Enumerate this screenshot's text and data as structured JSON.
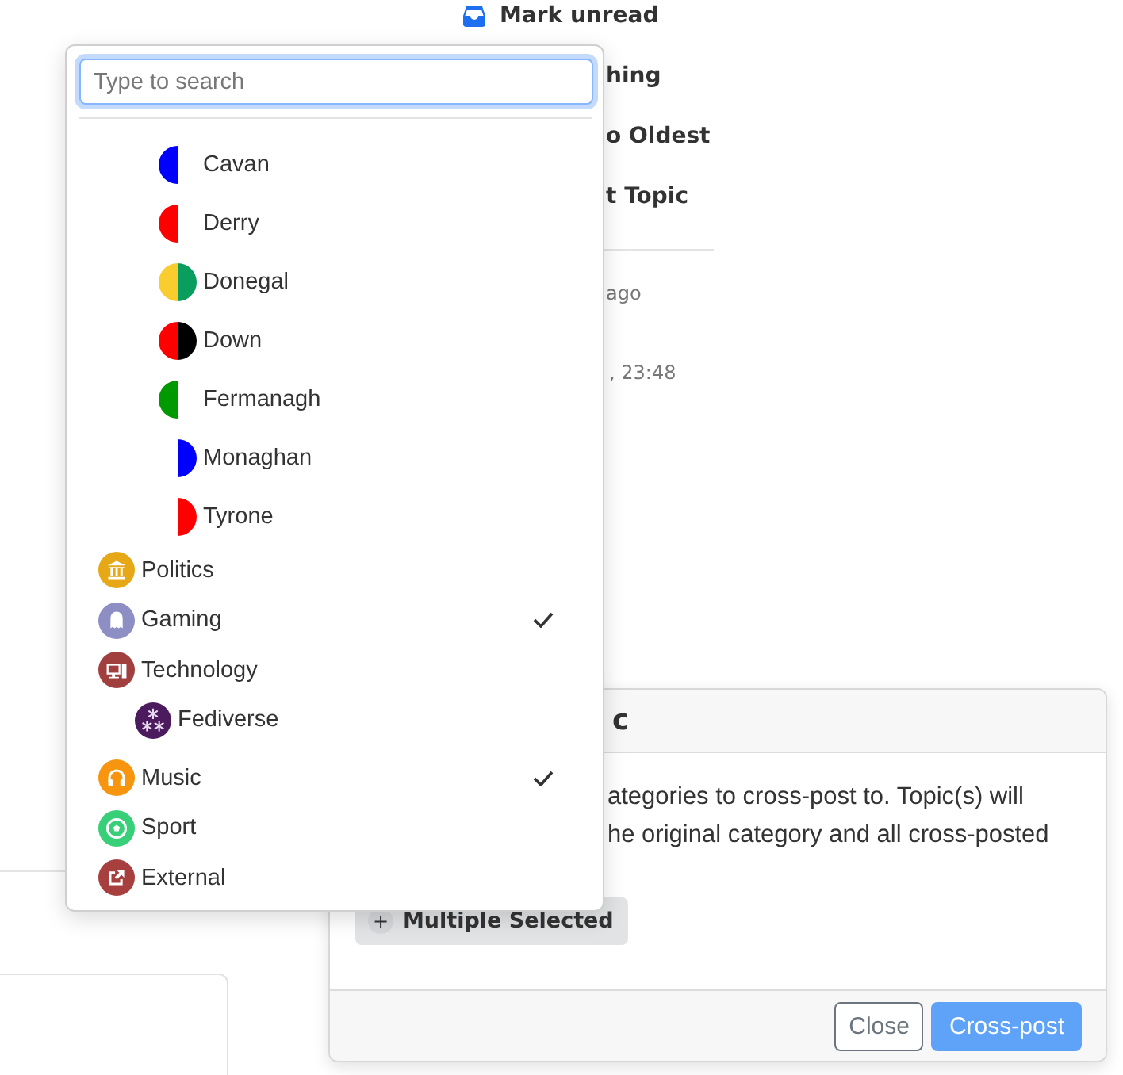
{
  "menu": [
    {
      "label": "Mark unread",
      "kind": "icon"
    },
    {
      "label": "hing",
      "kind": "clipped"
    },
    {
      "label": "o Oldest",
      "kind": "clipped"
    },
    {
      "label": "t Topic",
      "kind": "clipped"
    }
  ],
  "meta": [
    "ago",
    ", 23:48"
  ],
  "dropdown": {
    "search": {
      "placeholder": "Type to search"
    },
    "nested_items": [
      {
        "label": "Cavan",
        "halves": [
          {
            "kind": "left",
            "color": "#0000ff"
          }
        ],
        "selected": false
      },
      {
        "label": "Derry",
        "halves": [
          {
            "kind": "left",
            "color": "#ff0000"
          }
        ],
        "selected": false
      },
      {
        "label": "Donegal",
        "halves": [
          {
            "kind": "left",
            "color": "#f9cd2e"
          },
          {
            "kind": "right",
            "color": "#0a9e5e"
          }
        ],
        "selected": false
      },
      {
        "label": "Down",
        "halves": [
          {
            "kind": "left",
            "color": "#ff0000"
          },
          {
            "kind": "right",
            "color": "#000000"
          }
        ],
        "selected": false
      },
      {
        "label": "Fermanagh",
        "halves": [
          {
            "kind": "left",
            "color": "#009a00"
          }
        ],
        "selected": false
      },
      {
        "label": "Monaghan",
        "halves": [
          {
            "kind": "right",
            "color": "#0000ff"
          }
        ],
        "selected": false
      },
      {
        "label": "Tyrone",
        "halves": [
          {
            "kind": "right",
            "color": "#ff0000"
          }
        ],
        "selected": false
      }
    ],
    "categories": [
      {
        "label": "Politics",
        "color": "#e6a817",
        "selected": false
      },
      {
        "label": "Gaming",
        "color": "#8d8fc4",
        "selected": true
      },
      {
        "label": "Technology",
        "color": "#a13e3e",
        "selected": false,
        "children": [
          {
            "label": "Fediverse",
            "color": "#4b1b5e",
            "selected": false
          }
        ]
      },
      {
        "label": "Music",
        "color": "#f7950e",
        "selected": true
      },
      {
        "label": "Sport",
        "color": "#37cf78",
        "selected": false
      },
      {
        "label": "External",
        "color": "#a73f3f",
        "selected": false
      }
    ]
  },
  "modal": {
    "title": "c",
    "body_lines": [
      "ategories to cross-post to. Topic(s) will",
      "he original category and all cross-posted"
    ],
    "chip": {
      "icon": "+",
      "label": "Multiple Selected"
    },
    "buttons": [
      {
        "label": "Close",
        "kind": "secondary"
      },
      {
        "label": "Cross-post",
        "kind": "primary"
      }
    ]
  }
}
